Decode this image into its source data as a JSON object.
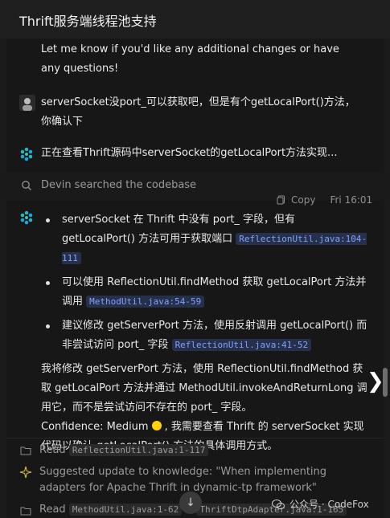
{
  "header": {
    "title": "Thrift服务端线程池支持"
  },
  "messages": {
    "prev_bot_tail": "Let me know if you'd like any additional changes or have any questions!",
    "user_msg": "serverSocket没port_可以获取吧，但是有个getLocalPort()方法，你确认下",
    "status": "正在查看Thrift源码中serverSocket的getLocalPort方法实现..."
  },
  "search": {
    "label": "Devin searched the codebase"
  },
  "meta": {
    "copy_label": "Copy",
    "time": "Fri 16:01"
  },
  "answer": {
    "bullets": [
      {
        "text": "serverSocket 在 Thrift 中没有 port_ 字段，但有 getLocalPort() 方法可用于获取端口",
        "code": "ReflectionUtil.java:104-111"
      },
      {
        "text": "可以使用 ReflectionUtil.findMethod 获取 getLocalPort 方法并调用",
        "code": "MethodUtil.java:54-59"
      },
      {
        "text": "建议修改 getServerPort 方法，使用反射调用 getLocalPort() 而非尝试访问 port_ 字段",
        "code": "ReflectionUtil.java:41-52"
      }
    ],
    "summary": "我将修改 getServerPort 方法，使用 ReflectionUtil.findMethod 获取 getLocalPort 方法并通过 MethodUtil.invokeAndReturnLong 调用它，而不是尝试访问不存在的 port_ 字段。",
    "confidence_label": "Confidence: Medium",
    "confidence_color": "#ffd400",
    "confidence_tail": ", 我需要查看 Thrift 的 serverSocket 实现代码以确认 getLocalPort() 方法的具体调用方式。"
  },
  "log": {
    "read1_label": "Read",
    "read1_file": "ReflectionUtil.java:1-117",
    "suggest_text": "Suggested update to knowledge: \"When implementing adapters for Apache Thrift in dynamic-tp framework\"",
    "read2_label": "Read",
    "read2_file": "MethodUtil.java:1-62",
    "read2_file2": "ThriftDtpAdapter.java:1-165"
  },
  "watermark": {
    "text": "公众号 · CodeFox"
  },
  "icons": {
    "spark": "devin-spark-icon",
    "search": "search-icon",
    "copy": "copy-icon",
    "chevron": "chevron-right-icon",
    "folder": "folder-icon",
    "sparkle": "sparkle-icon",
    "arrow_down": "arrow-down-icon"
  }
}
